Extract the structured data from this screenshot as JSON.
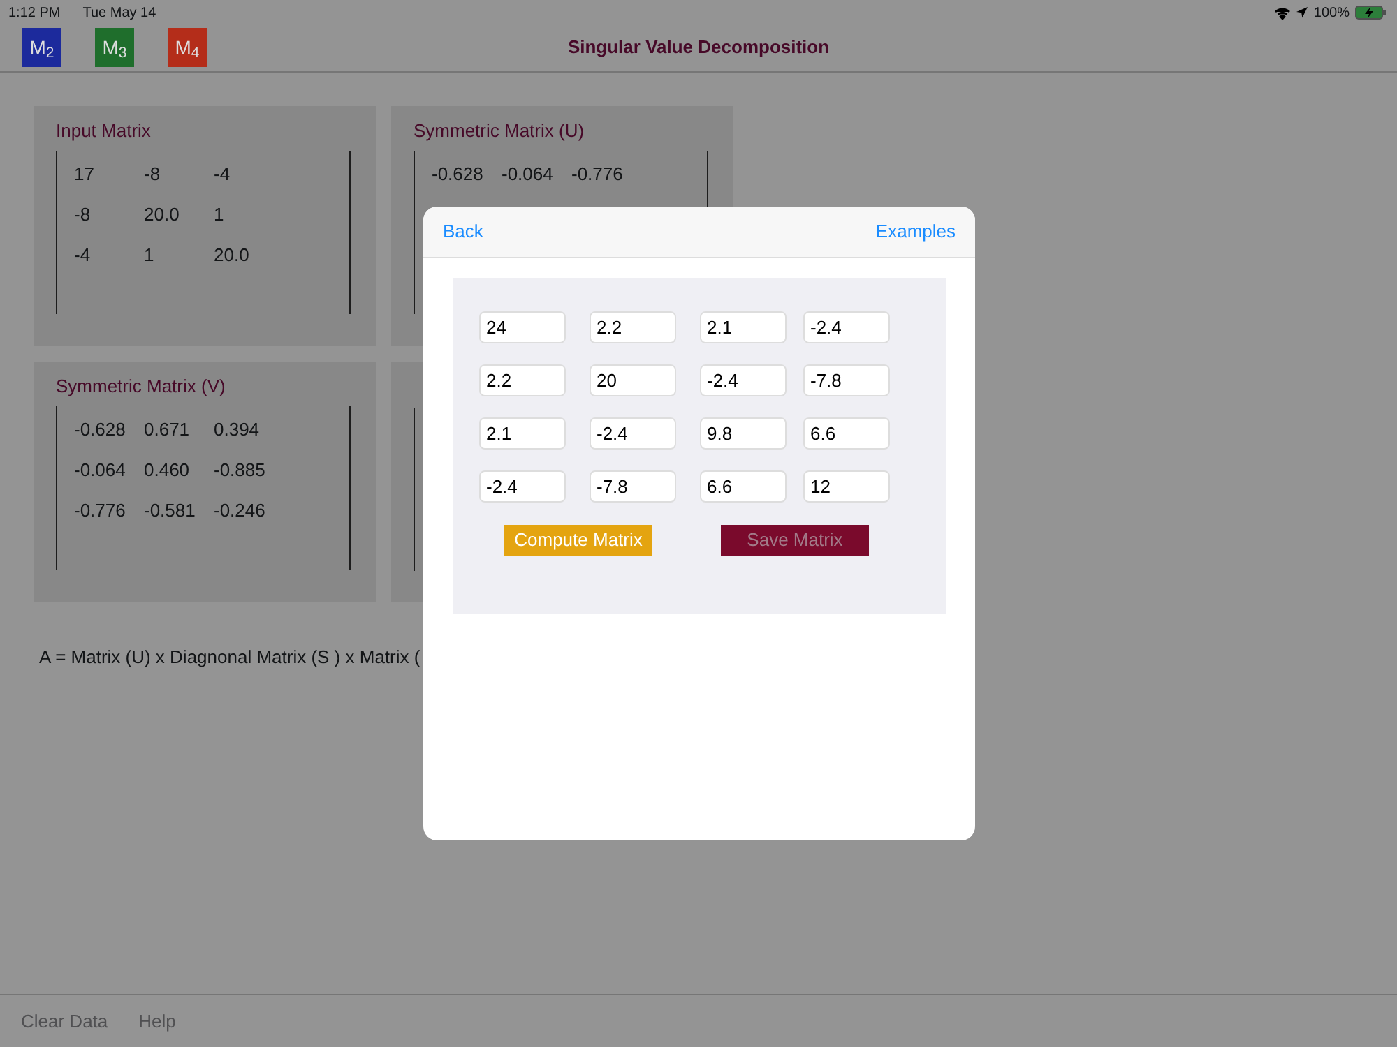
{
  "status_bar": {
    "time": "1:12 PM",
    "date": "Tue May 14",
    "battery": "100%"
  },
  "nav_bar": {
    "title": "Singular Value Decomposition",
    "matrix_buttons": [
      {
        "label": "M$_{2}$",
        "color": "#1c2a9c"
      },
      {
        "label": "M$_{3}$",
        "color": "#1f6e2c"
      },
      {
        "label": "M$_{4}$",
        "color": "#b42d1a"
      }
    ]
  },
  "panels": [
    {
      "title": "Input Matrix",
      "rows": [
        [
          "17",
          "-8",
          "-4"
        ],
        [
          "-8",
          "20.0",
          "1"
        ],
        [
          "-4",
          "1",
          "20.0"
        ]
      ]
    },
    {
      "title": "Symmetric Matrix (U)",
      "rows": [
        [
          "-0.628",
          "-0.064",
          "-0.776"
        ]
      ]
    },
    {
      "title": "Symmetric Matrix (V)",
      "rows": [
        [
          "-0.628",
          "0.671",
          "0.394"
        ],
        [
          "-0.064",
          "0.460",
          "-0.885"
        ],
        [
          "-0.776",
          "-0.581",
          "-0.246"
        ]
      ]
    }
  ],
  "formula": "A = Matrix (U)  x Diagnonal Matrix (S ) x Matrix (",
  "toolbar": [
    "Clear Data",
    "Help"
  ],
  "modal": {
    "back": "Back",
    "examples": "Examples",
    "cells": [
      [
        "24",
        "2.2",
        "2.1",
        "-2.4"
      ],
      [
        "2.2",
        "20",
        "-2.4",
        "-7.8"
      ],
      [
        "2.1",
        "-2.4",
        "9.8",
        "6.6"
      ],
      [
        "-2.4",
        "-7.8",
        "6.6",
        "12"
      ]
    ],
    "buttons": [
      {
        "label": "Compute Matrix",
        "kind": "compute",
        "disabled": false
      },
      {
        "label": "Save Matrix",
        "kind": "save",
        "disabled": true
      }
    ]
  }
}
